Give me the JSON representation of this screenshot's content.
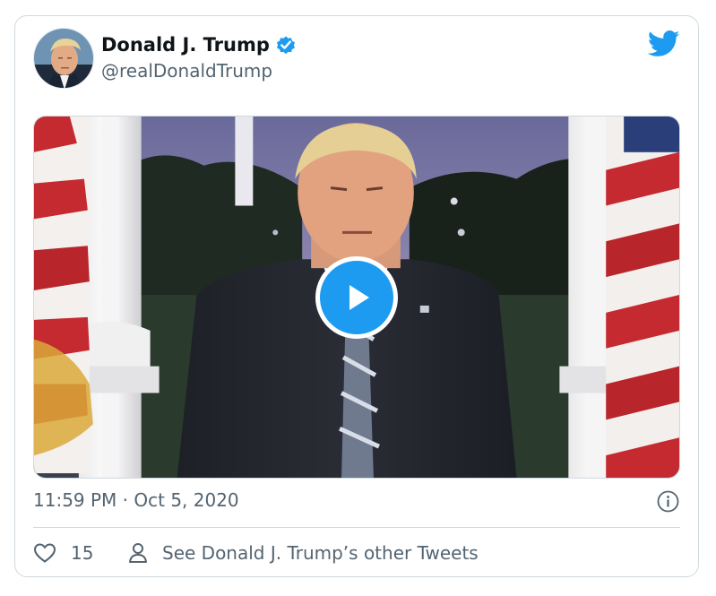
{
  "author": {
    "name": "Donald J. Trump",
    "handle": "@realDonaldTrump",
    "verified": true
  },
  "tweet": {
    "timestamp": "11:59 PM · Oct 5, 2020",
    "media_type": "video"
  },
  "actions": {
    "likes": "15",
    "other_tweets_label": "See Donald J. Trump’s other Tweets"
  },
  "icons": {
    "brand": "twitter-bird-icon",
    "verified": "verified-badge-icon",
    "play": "play-icon",
    "info": "info-icon",
    "like": "heart-icon",
    "profile": "person-icon"
  },
  "colors": {
    "accent": "#1d9bf0",
    "text_primary": "#0f1419",
    "text_secondary": "#536471",
    "border": "#cfd9de"
  }
}
